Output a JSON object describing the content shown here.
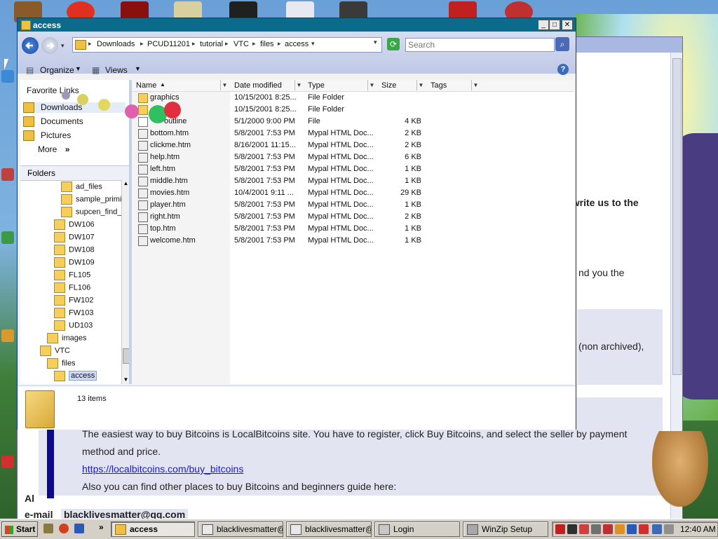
{
  "window": {
    "title": "access",
    "minimize": "_",
    "maximize": "□",
    "close": "✕"
  },
  "address": {
    "crumbs": [
      "Downloads",
      "PCUD11201",
      "tutorial",
      "VTC",
      "files",
      "access"
    ],
    "search_placeholder": "Search"
  },
  "toolbar": {
    "organize": "Organize",
    "views": "Views",
    "help": "?"
  },
  "favorites": {
    "header": "Favorite Links",
    "items": [
      "Downloads",
      "Documents",
      "Pictures",
      "More"
    ],
    "more_glyph": "»"
  },
  "folders": {
    "header": "Folders",
    "tree": [
      {
        "label": "ad_files"
      },
      {
        "label": "sample_primi"
      },
      {
        "label": "supcen_find_"
      },
      {
        "label": "DW106"
      },
      {
        "label": "DW107"
      },
      {
        "label": "DW108"
      },
      {
        "label": "DW109"
      },
      {
        "label": "FL105"
      },
      {
        "label": "FL106"
      },
      {
        "label": "FW102"
      },
      {
        "label": "FW103"
      },
      {
        "label": "UD103"
      },
      {
        "label": "images"
      },
      {
        "label": "VTC"
      },
      {
        "label": "files"
      },
      {
        "label": "access"
      }
    ]
  },
  "columns": [
    "Name",
    "Date modified",
    "Type",
    "Size",
    "Tags"
  ],
  "files": [
    {
      "name": "graphics",
      "date": "10/15/2001 8:25...",
      "type": "File Folder",
      "size": "",
      "icon": "folder"
    },
    {
      "name": "",
      "date": "10/15/2001 8:25...",
      "type": "File Folder",
      "size": "",
      "icon": "folder"
    },
    {
      "name": "outline",
      "date": "5/1/2000 9:00 PM",
      "type": "File",
      "size": "4 KB",
      "icon": "file"
    },
    {
      "name": "bottom.htm",
      "date": "5/8/2001 7:53 PM",
      "type": "Mypal HTML Doc...",
      "size": "2 KB",
      "icon": "html"
    },
    {
      "name": "clickme.htm",
      "date": "8/16/2001 11:15...",
      "type": "Mypal HTML Doc...",
      "size": "2 KB",
      "icon": "html"
    },
    {
      "name": "help.htm",
      "date": "5/8/2001 7:53 PM",
      "type": "Mypal HTML Doc...",
      "size": "6 KB",
      "icon": "html"
    },
    {
      "name": "left.htm",
      "date": "5/8/2001 7:53 PM",
      "type": "Mypal HTML Doc...",
      "size": "1 KB",
      "icon": "html"
    },
    {
      "name": "middle.htm",
      "date": "5/8/2001 7:53 PM",
      "type": "Mypal HTML Doc...",
      "size": "1 KB",
      "icon": "html"
    },
    {
      "name": "movies.htm",
      "date": "10/4/2001 9:11 ...",
      "type": "Mypal HTML Doc...",
      "size": "29 KB",
      "icon": "html"
    },
    {
      "name": "player.htm",
      "date": "5/8/2001 7:53 PM",
      "type": "Mypal HTML Doc...",
      "size": "1 KB",
      "icon": "html"
    },
    {
      "name": "right.htm",
      "date": "5/8/2001 7:53 PM",
      "type": "Mypal HTML Doc...",
      "size": "2 KB",
      "icon": "html"
    },
    {
      "name": "top.htm",
      "date": "5/8/2001 7:53 PM",
      "type": "Mypal HTML Doc...",
      "size": "1 KB",
      "icon": "html"
    },
    {
      "name": "welcome.htm",
      "date": "5/8/2001 7:53 PM",
      "type": "Mypal HTML Doc...",
      "size": "1 KB",
      "icon": "html"
    }
  ],
  "status": {
    "count": "13 items"
  },
  "background_page": {
    "line1": ", write us to the",
    "line2": "nd you the",
    "line3": "(non archived),",
    "line4": "The easiest way to buy Bitcoins is LocalBitcoins site. You have to register, click Buy Bitcoins, and select the seller by payment",
    "line5": "method and price.",
    "link": "https://localbitcoins.com/buy_bitcoins",
    "line6": "Also you can find other places to buy Bitcoins and beginners guide here:",
    "al": "Al",
    "email_label": "e-mail",
    "email": "blacklivesmatter@qq.com"
  },
  "taskbar": {
    "start": "Start",
    "ql_more": "»",
    "tasks": [
      "access",
      "blacklivesmatter@...",
      "blacklivesmatter@...",
      "Login",
      "WinZip Setup"
    ],
    "clock": "12:40 AM"
  },
  "colors": {
    "title_bar": "#0a6b8a",
    "selection": "#cfdbf5",
    "link": "#1a1acc"
  }
}
